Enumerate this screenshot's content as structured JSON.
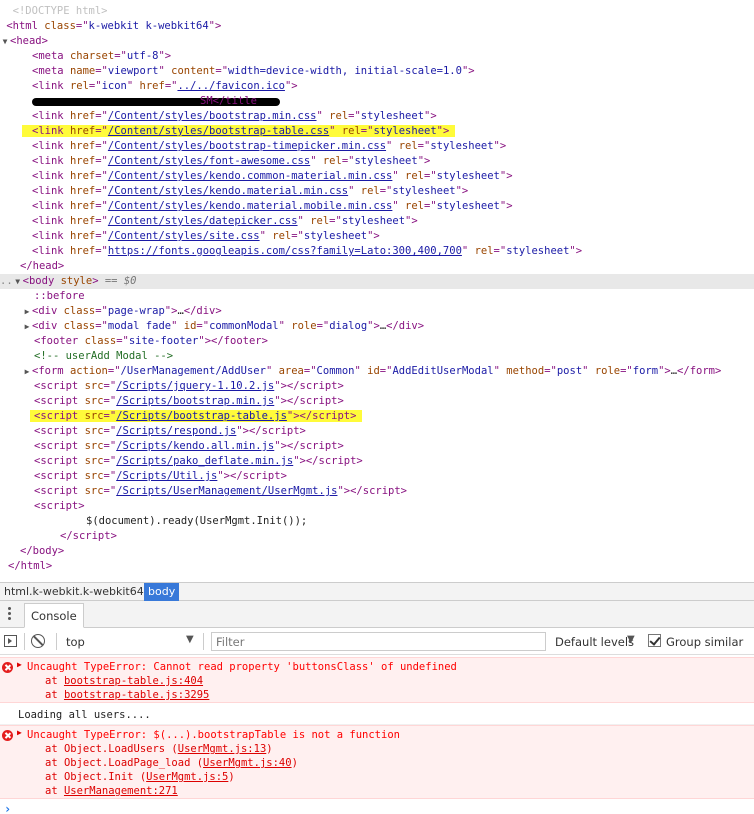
{
  "elements": {
    "doctype": "<!DOCTYPE html>",
    "html_open": {
      "tag": "html",
      "class": "k-webkit k-webkit64"
    },
    "head_open": "head",
    "meta_charset": "utf-8",
    "meta_viewport_name": "viewport",
    "meta_viewport_content": "width=device-width, initial-scale=1.0",
    "link_icon_rel": "icon",
    "link_icon_href": "../../favicon.ico",
    "title_tail": "SM</title",
    "stylesheets": [
      "/Content/styles/bootstrap.min.css",
      "/Content/styles/bootstrap-table.css",
      "/Content/styles/bootstrap-timepicker.min.css",
      "/Content/styles/font-awesome.css",
      "/Content/styles/kendo.common-material.min.css",
      "/Content/styles/kendo.material.min.css",
      "/Content/styles/kendo.material.mobile.min.css",
      "/Content/styles/datepicker.css",
      "/Content/styles/site.css",
      "https://fonts.googleapis.com/css?family=Lato:300,400,700"
    ],
    "rel_stylesheet": "stylesheet",
    "head_close": "</head>",
    "body_attr": "style",
    "body_eq": "== $0",
    "before_pseudo": "::before",
    "div_pagewrap_class": "page-wrap",
    "div_modal_class": "modal fade",
    "div_modal_id": "commonModal",
    "div_modal_role": "dialog",
    "footer_class": "site-footer",
    "comment_text": "<!-- userAdd Modal -->",
    "form_action": "/UserManagement/AddUser",
    "form_area": "Common",
    "form_id": "AddEditUserModal",
    "form_method": "post",
    "form_role": "form",
    "scripts": [
      "/Scripts/jquery-1.10.2.js",
      "/Scripts/bootstrap.min.js",
      "/Scripts/bootstrap-table.js",
      "/Scripts/respond.js",
      "/Scripts/kendo.all.min.js",
      "/Scripts/pako_deflate.min.js",
      "/Scripts/Util.js",
      "/Scripts/UserManagement/UserMgmt.js"
    ],
    "inline_script_code": "$(document).ready(UserMgmt.Init());",
    "body_close": "</body>",
    "html_close": "</html>"
  },
  "breadcrumb": {
    "items": [
      "html.k-webkit.k-webkit64",
      "body"
    ]
  },
  "drawer": {
    "tab_console": "Console"
  },
  "toolbar": {
    "context": "top",
    "filter_placeholder": "Filter",
    "levels_label": "Default levels",
    "group_similar_label": "Group similar"
  },
  "console": {
    "error1": {
      "message": "Uncaught TypeError: Cannot read property 'buttonsClass' of undefined",
      "stack": [
        {
          "prefix": "at ",
          "link": "bootstrap-table.js:404"
        },
        {
          "prefix": "at ",
          "link": "bootstrap-table.js:3295"
        }
      ]
    },
    "info1": "Loading all users....",
    "error2": {
      "message": "Uncaught TypeError: $(...).bootstrapTable is not a function",
      "stack": [
        {
          "prefix": "at Object.LoadUsers (",
          "link": "UserMgmt.js:13",
          "suffix": ")"
        },
        {
          "prefix": "at Object.LoadPage_load (",
          "link": "UserMgmt.js:40",
          "suffix": ")"
        },
        {
          "prefix": "at Object.Init (",
          "link": "UserMgmt.js:5",
          "suffix": ")"
        },
        {
          "prefix": "at ",
          "link": "UserManagement:271",
          "suffix": ""
        }
      ]
    },
    "prompt": "›"
  }
}
